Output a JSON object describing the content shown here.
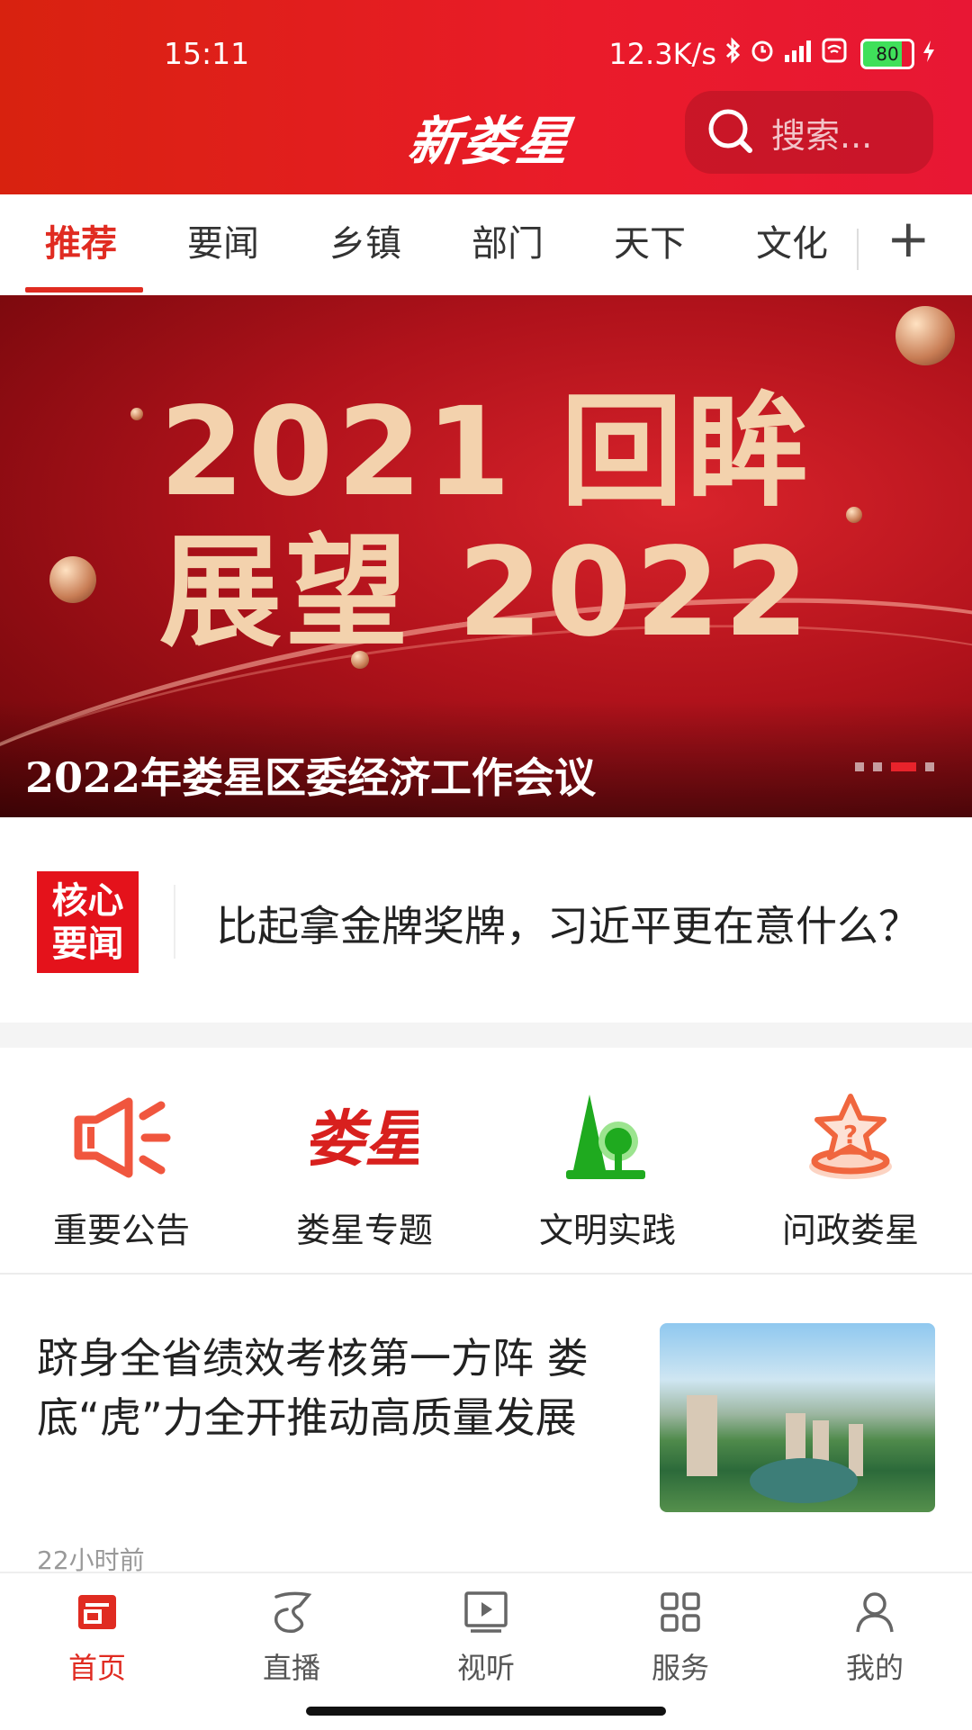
{
  "status_bar": {
    "time": "15:11",
    "network_speed": "12.3K/s",
    "battery": "80"
  },
  "header": {
    "logo_text": "新娄星",
    "search_placeholder": "搜索..."
  },
  "tabs": [
    "推荐",
    "要闻",
    "乡镇",
    "部门",
    "天下",
    "文化"
  ],
  "active_tab": "推荐",
  "banner": {
    "line1": "2021 回眸",
    "line2": "展望 2022",
    "caption": "2022年娄星区委经济工作会议",
    "slide_count": 4,
    "active_slide": 3
  },
  "core_news": {
    "badge_line1": "核心",
    "badge_line2": "要闻",
    "headline": "比起拿金牌奖牌，习近平更在意什么？"
  },
  "quick_links": [
    {
      "label": "重要公告",
      "icon": "megaphone-icon"
    },
    {
      "label": "娄星专题",
      "icon": "louxing-logo-icon"
    },
    {
      "label": "文明实践",
      "icon": "tree-icon"
    },
    {
      "label": "问政娄星",
      "icon": "question-star-icon"
    }
  ],
  "news_item": {
    "title": "跻身全省绩效考核第一方阵 娄底“虎”力全开推动高质量发展",
    "time": "22小时前"
  },
  "bottom_nav": [
    {
      "label": "首页",
      "icon": "home-icon"
    },
    {
      "label": "直播",
      "icon": "live-icon"
    },
    {
      "label": "视听",
      "icon": "video-icon"
    },
    {
      "label": "服务",
      "icon": "grid-icon"
    },
    {
      "label": "我的",
      "icon": "user-icon"
    }
  ],
  "colors": {
    "brand_red": "#e02b21",
    "header_red": "#e81734"
  }
}
